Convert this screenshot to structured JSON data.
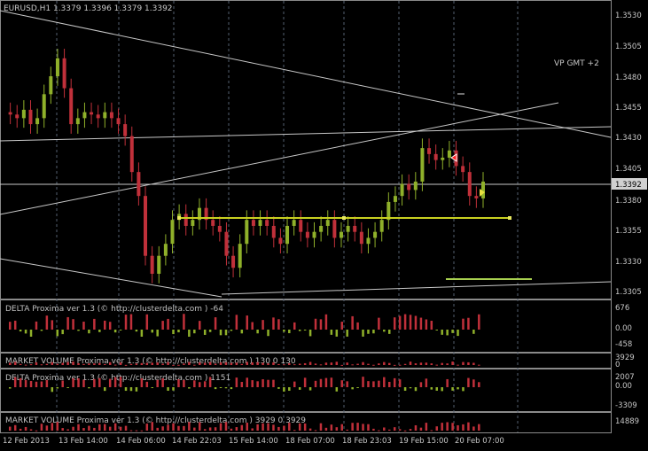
{
  "header": {
    "symbol_line": "EURUSD,H1  1.3379 1.3396 1.3379 1.3392"
  },
  "main": {
    "annotation": "VP GMT +2",
    "price_axis": [
      "1.3530",
      "1.3505",
      "1.3480",
      "1.3455",
      "1.3430",
      "1.3405",
      "1.3380",
      "1.3355",
      "1.3330",
      "1.3305"
    ],
    "current_price": "1.3392"
  },
  "indicators": [
    {
      "label": "DELTA Proxima ver 1.3 (© http://clusterdelta.com ) -64",
      "scale": [
        "676",
        "0.00",
        "-458"
      ]
    },
    {
      "label": "MARKET VOLUME Proxima ver 1.3 (© http://clusterdelta.com ) 130 0 130",
      "scale": [
        "3929",
        "0"
      ]
    },
    {
      "label": "DELTA Proxima ver 1.3 (© http://clusterdelta.com ) 1151",
      "scale": [
        "2007",
        "0.00",
        "-3309"
      ]
    },
    {
      "label": "MARKET VOLUME Proxima ver 1.3 (© http://clusterdelta.com ) 3929 0 3929",
      "scale": [
        "14889"
      ]
    }
  ],
  "time_axis": [
    "12 Feb 2013",
    "13 Feb 14:00",
    "14 Feb 06:00",
    "14 Feb 22:03",
    "15 Feb 14:00",
    "18 Feb 07:00",
    "18 Feb 23:03",
    "19 Feb 15:00",
    "20 Feb 07:00"
  ],
  "colors": {
    "background": "#000000",
    "bull": "#8fb02a",
    "bear": "#c0303a",
    "grid": "#556070",
    "level": "#c8d020",
    "frame": "#8a8a8a"
  },
  "chart_data": {
    "type": "candlestick",
    "title": "EURUSD,H1",
    "ylim": [
      1.3295,
      1.354
    ],
    "close_series": [
      1.345,
      1.3448,
      1.3445,
      1.3452,
      1.344,
      1.3445,
      1.3465,
      1.348,
      1.3495,
      1.347,
      1.344,
      1.3445,
      1.345,
      1.3448,
      1.3445,
      1.345,
      1.3445,
      1.344,
      1.343,
      1.34,
      1.338,
      1.333,
      1.3315,
      1.333,
      1.334,
      1.336,
      1.3365,
      1.3355,
      1.336,
      1.337,
      1.336,
      1.3355,
      1.335,
      1.333,
      1.332,
      1.334,
      1.336,
      1.3355,
      1.336,
      1.3355,
      1.3345,
      1.334,
      1.3355,
      1.336,
      1.335,
      1.3345,
      1.335,
      1.3355,
      1.336,
      1.3345,
      1.335,
      1.3355,
      1.335,
      1.334,
      1.3345,
      1.335,
      1.336,
      1.3375,
      1.338,
      1.339,
      1.3385,
      1.3392,
      1.342,
      1.3415,
      1.341,
      1.3412,
      1.3418,
      1.3405,
      1.34,
      1.338,
      1.3378,
      1.3392
    ]
  }
}
